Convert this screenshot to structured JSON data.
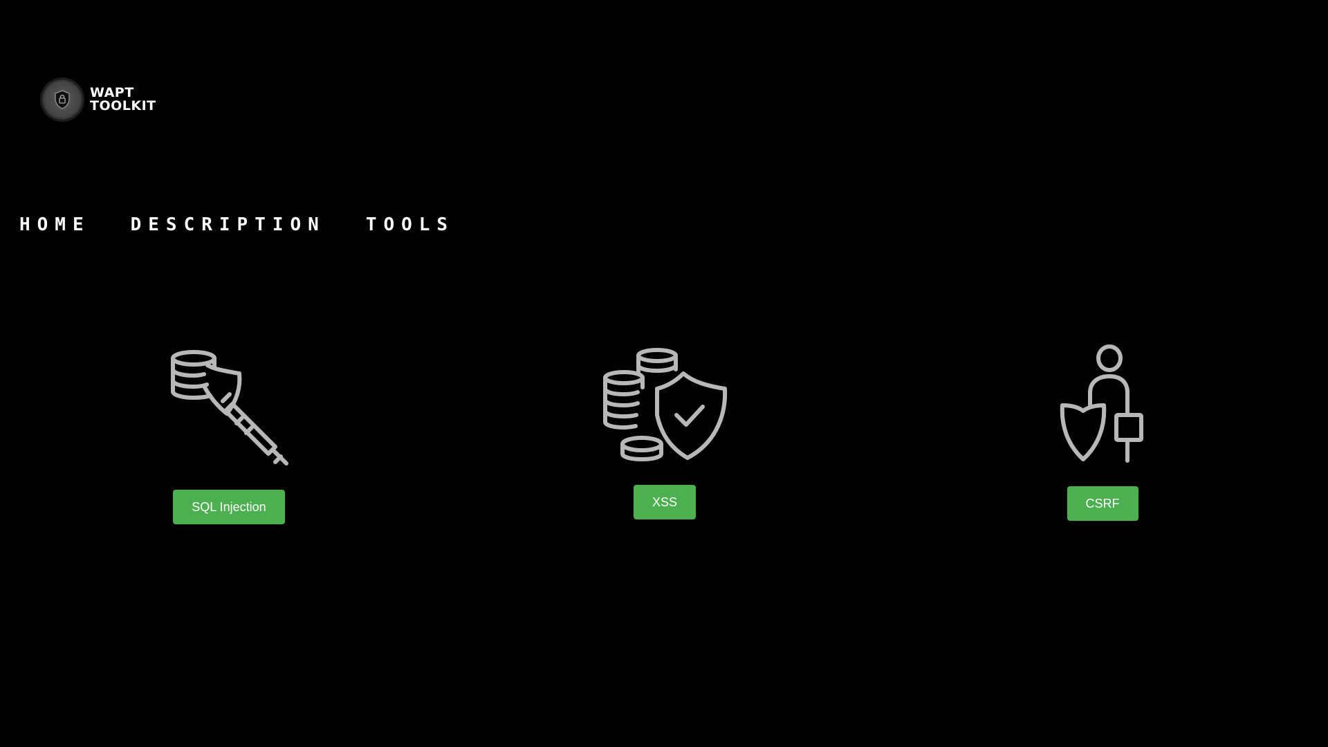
{
  "logo": {
    "line1": "WAPT",
    "line2": "TOOLKIT",
    "icon": "shield-lock-icon"
  },
  "nav": {
    "home": "HOME",
    "description": "DESCRIPTION",
    "tools": "TOOLS"
  },
  "tools": [
    {
      "label": "SQL Injection",
      "icon": "database-syringe-icon"
    },
    {
      "label": "XSS",
      "icon": "coins-shield-icon"
    },
    {
      "label": "CSRF",
      "icon": "person-shield-icon"
    }
  ],
  "colors": {
    "background": "#000000",
    "button": "#4caf50",
    "icon": "#b8b8b8"
  }
}
